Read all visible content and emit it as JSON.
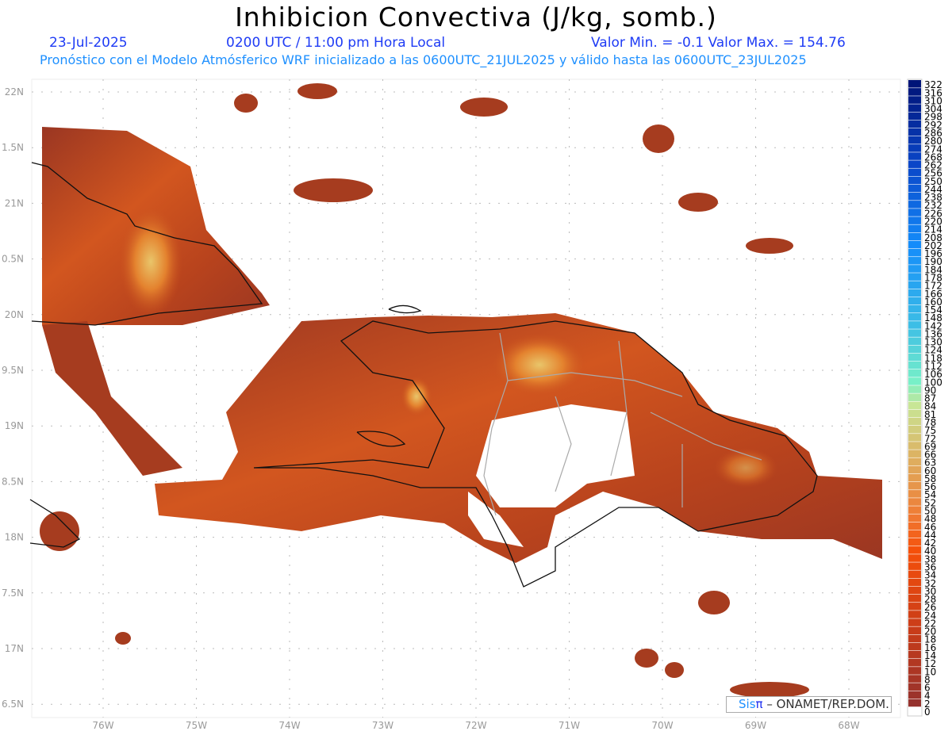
{
  "header": {
    "title": "Inhibicion Convectiva (J/kg, somb.)",
    "date": "23-Jul-2025",
    "time": "0200 UTC / 11:00 pm Hora Local",
    "minmax": "Valor Min. = -0.1  Valor Max. = 154.76",
    "description": "Pronóstico con el Modelo Atmósferico WRF inicializado a las 0600UTC_21JUL2025 y válido hasta las  0600UTC_23JUL2025"
  },
  "map": {
    "lat_labels": [
      "22N",
      "1.5N",
      "21N",
      "0.5N",
      "20N",
      "9.5N",
      "19N",
      "8.5N",
      "18N",
      "7.5N",
      "17N",
      "6.5N"
    ],
    "lon_labels": [
      "76W",
      "75W",
      "74W",
      "73W",
      "72W",
      "71W",
      "70W",
      "69W",
      "68W"
    ]
  },
  "colorbar": {
    "labels": [
      "322",
      "316",
      "310",
      "304",
      "298",
      "292",
      "286",
      "280",
      "274",
      "268",
      "262",
      "256",
      "250",
      "244",
      "238",
      "232",
      "226",
      "220",
      "214",
      "208",
      "202",
      "196",
      "190",
      "184",
      "178",
      "172",
      "166",
      "160",
      "154",
      "148",
      "142",
      "136",
      "130",
      "124",
      "118",
      "112",
      "106",
      "100",
      "90",
      "87",
      "84",
      "81",
      "78",
      "75",
      "72",
      "69",
      "66",
      "63",
      "60",
      "58",
      "56",
      "54",
      "52",
      "50",
      "48",
      "46",
      "44",
      "42",
      "40",
      "38",
      "36",
      "34",
      "32",
      "30",
      "28",
      "26",
      "24",
      "22",
      "20",
      "18",
      "16",
      "14",
      "12",
      "10",
      "8",
      "6",
      "4",
      "2",
      "0"
    ]
  },
  "credit": {
    "sis": "Sis",
    "pi": "π",
    "org": " –  ONAMET/REP.DOM."
  }
}
